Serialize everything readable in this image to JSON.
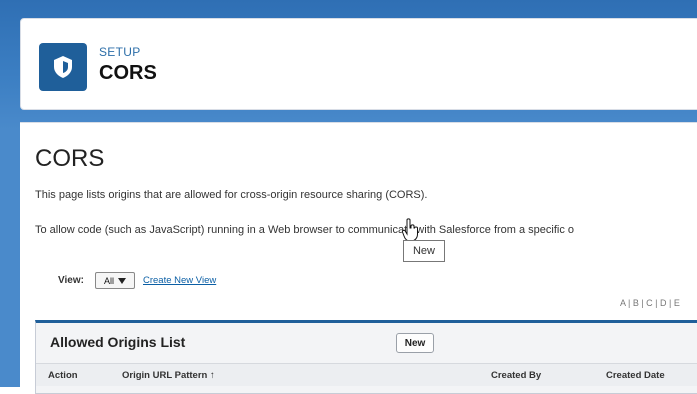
{
  "header": {
    "kicker": "SETUP",
    "title": "CORS",
    "logo_icon": "shield-icon"
  },
  "main": {
    "heading": "CORS",
    "description": "This page lists origins that are allowed for cross-origin resource sharing (CORS).",
    "description2": "To allow code (such as JavaScript) running in a Web browser to communicate with Salesforce from a specific o",
    "view": {
      "label": "View:",
      "selected": "All",
      "create_link": "Create New View"
    },
    "alpha_index": "A | B | C | D | E",
    "list": {
      "title": "Allowed Origins List",
      "new_button": "New",
      "columns": [
        "Action",
        "Origin URL Pattern ↑",
        "Created By",
        "Created Date"
      ]
    },
    "tooltip": "New"
  },
  "colors": {
    "brand": "#1f5f9a",
    "band": "#3c7fc3",
    "link": "#0b5fa5"
  }
}
